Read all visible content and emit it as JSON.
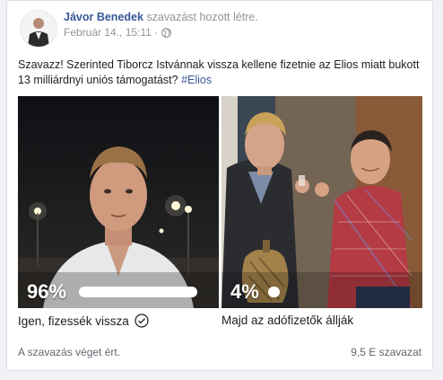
{
  "post": {
    "author": "Jávor Benedek",
    "action_text": "szavazást hozott létre.",
    "date": "Február 14., 15:11 ·",
    "privacy_icon": "globe-icon",
    "text": "Szavazz! Szerinted Tiborcz Istvánnak vissza kellene fizetnie az Elios miatt bukott 13 milliárdnyi uniós támogatást?",
    "hashtag": "#Elios"
  },
  "poll": {
    "options": [
      {
        "percent_label": "96%",
        "percent": 96,
        "label": "Igen, fizessék vissza",
        "selected_icon": "check-circle-icon"
      },
      {
        "percent_label": "4%",
        "percent": 4,
        "label": "Majd az adófizetők állják"
      }
    ],
    "status": "A szavazás véget ért.",
    "vote_count": "9,5 E szavazat"
  },
  "colors": {
    "link": "#385898",
    "muted": "#90949c",
    "bar": "#ffffff"
  }
}
